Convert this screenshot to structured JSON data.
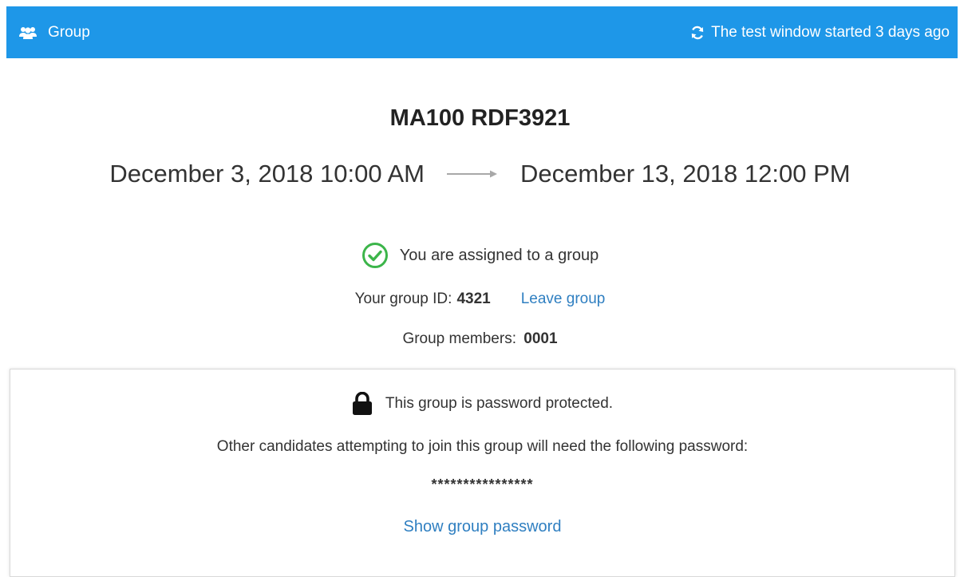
{
  "header": {
    "group_label": "Group",
    "status_text": "The test window started 3 days ago",
    "background_color": "#1e97e8",
    "group_icon": "users-icon",
    "status_icon": "refresh-icon"
  },
  "exam": {
    "title": "MA100 RDF3921",
    "start": "December 3, 2018 10:00 AM",
    "end": "December 13, 2018 12:00 PM",
    "arrow_icon": "arrow-right-icon"
  },
  "group": {
    "assigned_text": "You are assigned to a group",
    "assigned_icon": "check-circle-icon",
    "id_label": "Your group ID:",
    "id_value": "4321",
    "leave_link": "Leave group",
    "members_label": "Group members:",
    "members_value": "0001"
  },
  "password": {
    "lock_icon": "lock-icon",
    "protected_text": "This group is password protected.",
    "instructions": "Other candidates attempting to join this group will need the following password:",
    "masked_value": "****************",
    "show_link": "Show group password",
    "link_color": "#2f7fc1"
  }
}
